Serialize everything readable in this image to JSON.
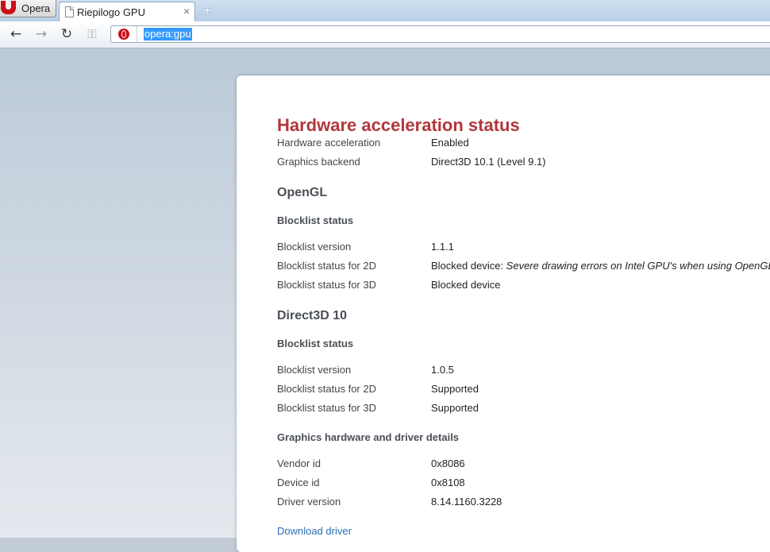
{
  "browser": {
    "menu_label": "Opera",
    "tab_title": "Riepilogo GPU",
    "tab_close": "×",
    "new_tab": "+",
    "address": "opera:gpu",
    "icons": {
      "back": "arrow-left-icon",
      "forward": "arrow-right-icon",
      "reload": "reload-icon",
      "key": "key-icon",
      "site": "opera-logo-icon"
    }
  },
  "page": {
    "title": "Hardware acceleration status",
    "summary": [
      {
        "key": "Hardware acceleration",
        "value": "Enabled"
      },
      {
        "key": "Graphics backend",
        "value": "Direct3D 10.1 (Level 9.1)"
      }
    ],
    "opengl": {
      "heading": "OpenGL",
      "subheading": "Blocklist status",
      "rows": [
        {
          "key": "Blocklist version",
          "value": "1.1.1"
        },
        {
          "key": "Blocklist status for 2D",
          "value": "Blocked device: ",
          "note": "Severe drawing errors on Intel GPU's when using OpenGL"
        },
        {
          "key": "Blocklist status for 3D",
          "value": "Blocked device"
        }
      ]
    },
    "d3d": {
      "heading": "Direct3D 10",
      "subheading": "Blocklist status",
      "rows": [
        {
          "key": "Blocklist version",
          "value": "1.0.5"
        },
        {
          "key": "Blocklist status for 2D",
          "value": "Supported"
        },
        {
          "key": "Blocklist status for 3D",
          "value": "Supported"
        }
      ]
    },
    "details": {
      "heading": "Graphics hardware and driver details",
      "rows": [
        {
          "key": "Vendor id",
          "value": "0x8086"
        },
        {
          "key": "Device id",
          "value": "0x8108"
        },
        {
          "key": "Driver version",
          "value": "8.14.1160.3228"
        }
      ]
    },
    "download_link": "Download driver"
  },
  "colors": {
    "title": "#b3363c",
    "link": "#2b6fb6",
    "selection": "#3399ff",
    "opera_red": "#cc0f16"
  }
}
